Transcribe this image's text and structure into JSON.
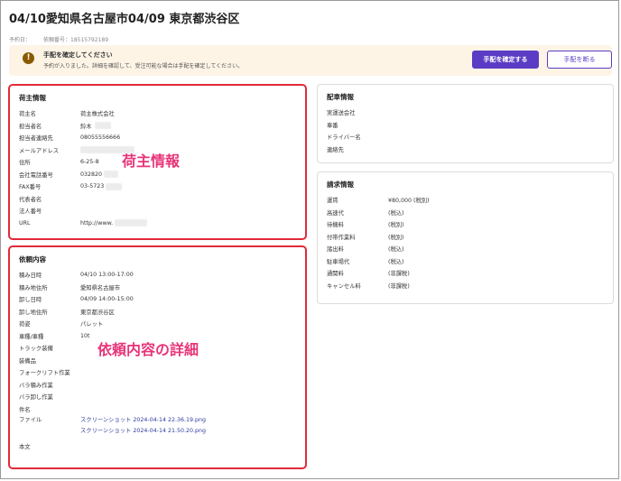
{
  "title": "04/10愛知県名古屋市04/09 東京都渋谷区",
  "meta": {
    "scheduled_label": "予約日：",
    "request_no_label": "依頼番号：",
    "request_no": "18515792189"
  },
  "alert": {
    "title": "手配を確定してください",
    "text": "予約が入りました。詳細を確認して、受注可能な場合は手配を確定してください。",
    "confirm_label": "手配を確定する",
    "decline_label": "手配を断る"
  },
  "shipper": {
    "title": "荷主情報",
    "overlay": "荷主情報",
    "rows": [
      {
        "label": "荷主名",
        "value": "荷主株式会社"
      },
      {
        "label": "担当者名",
        "value": "鈴木"
      },
      {
        "label": "担当者連絡先",
        "value": "08055556666"
      },
      {
        "label": "メールアドレス",
        "value": ""
      },
      {
        "label": "住所",
        "value": "6-25-8"
      },
      {
        "label": "会社電話番号",
        "value": "032820"
      },
      {
        "label": "FAX番号",
        "value": "03-5723"
      },
      {
        "label": "代表者名",
        "value": ""
      },
      {
        "label": "法人番号",
        "value": ""
      },
      {
        "label": "URL",
        "value": "http://www."
      }
    ]
  },
  "request": {
    "title": "依頼内容",
    "overlay": "依頼内容の詳細",
    "rows": [
      {
        "label": "積み日時",
        "value": "04/10 13:00-17:00"
      },
      {
        "label": "積み地住所",
        "value": "愛知県名古屋市"
      },
      {
        "label": "卸し日時",
        "value": "04/09 14:00-15:00"
      },
      {
        "label": "卸し地住所",
        "value": "東京都渋谷区"
      },
      {
        "label": "荷姿",
        "value": "パレット"
      },
      {
        "label": "車種/車種",
        "value": "10t"
      },
      {
        "label": "トラック装備",
        "value": ""
      },
      {
        "label": "装備品",
        "value": ""
      },
      {
        "label": "フォークリフト作業",
        "value": ""
      },
      {
        "label": "バラ積み作業",
        "value": ""
      },
      {
        "label": "バラ卸し作業",
        "value": ""
      },
      {
        "label": "件名",
        "value": ""
      }
    ],
    "file_label": "ファイル",
    "files": [
      "スクリーンショット 2024-04-14 22.36.19.png",
      "スクリーンショット 2024-04-14 21.50.20.png"
    ],
    "body_label": "本文"
  },
  "dispatch": {
    "title": "配車情報",
    "rows": [
      {
        "label": "実運送会社",
        "value": ""
      },
      {
        "label": "車番",
        "value": ""
      },
      {
        "label": "ドライバー名",
        "value": ""
      },
      {
        "label": "連絡先",
        "value": ""
      }
    ]
  },
  "billing": {
    "title": "請求情報",
    "rows": [
      {
        "label": "運賃",
        "value": "¥80,000 (税別)"
      },
      {
        "label": "高速代",
        "value": "(税込)"
      },
      {
        "label": "待機料",
        "value": "(税別)"
      },
      {
        "label": "付帯作業料",
        "value": "(税別)"
      },
      {
        "label": "諸出料",
        "value": "(税込)"
      },
      {
        "label": "駐車場代",
        "value": "(税込)"
      },
      {
        "label": "通関料",
        "value": "(非課税)"
      },
      {
        "label": "キャンセル料",
        "value": "(非課税)"
      }
    ]
  },
  "colors": {
    "accent": "#5b3cc4",
    "highlight_border": "#e02a3a",
    "overlay_text": "#e8357a",
    "alert_bg": "#fdf4e6"
  }
}
